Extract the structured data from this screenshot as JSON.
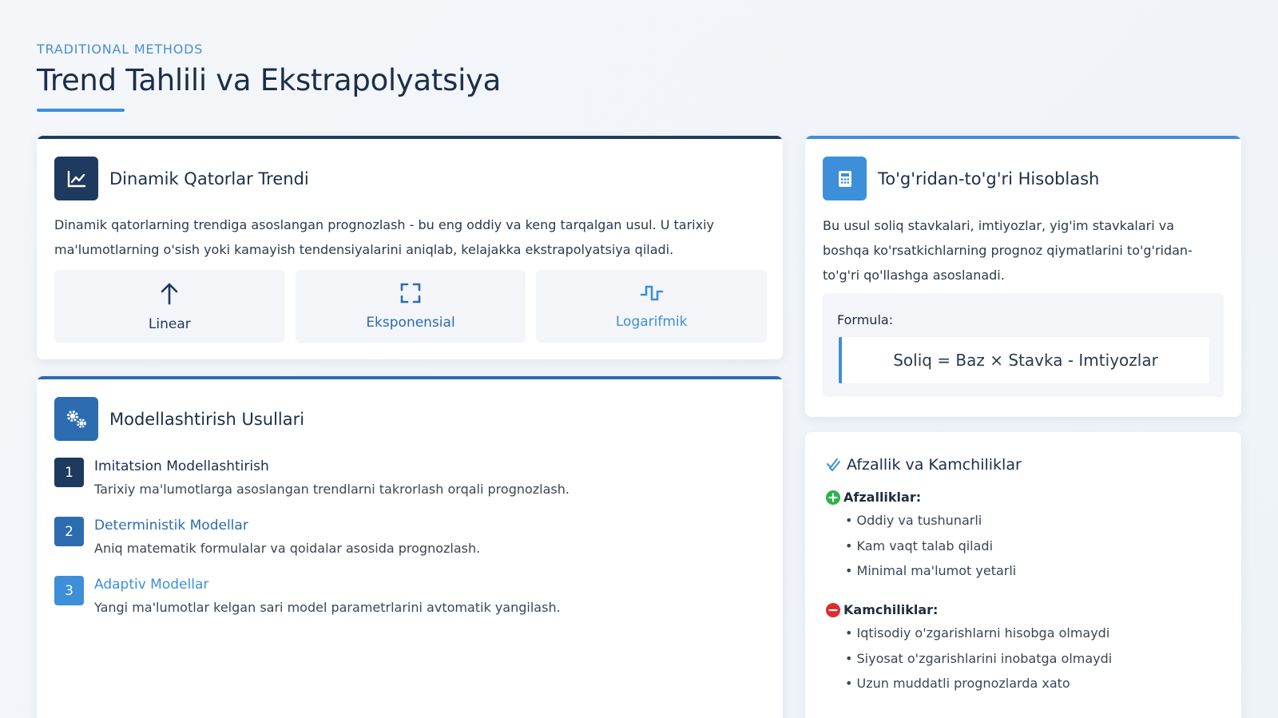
{
  "header": {
    "eyebrow": "TRADITIONAL METHODS",
    "title": "Trend Tahlili va Ekstrapolyatsiya"
  },
  "colors": {
    "navy": "#1e3a5f",
    "mid_blue": "#2c6cb0",
    "light_blue": "#3d8fd9",
    "green": "#2bb34a",
    "red": "#e02b2b"
  },
  "trend_card": {
    "icon": "chart-line-icon",
    "title": "Dinamik Qatorlar Trendi",
    "description": "Dinamik qatorlarning trendiga asoslangan prognozlash - bu eng oddiy va keng tarqalgan usul. U tarixiy ma'lumotlarning o'sish yoki kamayish tendensiyalarini aniqlab, kelajakka ekstrapolyatsiya qiladi.",
    "methods": [
      {
        "label": "Linear",
        "icon": "arrow-up-icon"
      },
      {
        "label": "Eksponensial",
        "icon": "expand-icon"
      },
      {
        "label": "Logarifmik",
        "icon": "wave-square-icon"
      }
    ]
  },
  "models_card": {
    "icon": "cogs-icon",
    "title": "Modellashtirish Usullari",
    "items": [
      {
        "num": "1",
        "title": "Imitatsion Modellashtirish",
        "desc": "Tarixiy ma'lumotlarga asoslangan trendlarni takrorlash orqali prognozlash."
      },
      {
        "num": "2",
        "title": "Deterministik Modellar",
        "desc": "Aniq matematik formulalar va qoidalar asosida prognozlash."
      },
      {
        "num": "3",
        "title": "Adaptiv Modellar",
        "desc": "Yangi ma'lumotlar kelgan sari model parametrlarini avtomatik yangilash."
      }
    ]
  },
  "calc_card": {
    "icon": "calculator-icon",
    "title": "To'g'ridan-to'g'ri Hisoblash",
    "description": "Bu usul soliq stavkalari, imtiyozlar, yig'im stavkalari va boshqa ko'rsatkichlarning prognoz qiymatlarini to'g'ridan-to'g'ri qo'llashga asoslanadi.",
    "formula_label": "Formula:",
    "formula": "Soliq = Baz × Stavka - Imtiyozlar"
  },
  "pros_card": {
    "icon": "check-double-icon",
    "title": "Afzallik va Kamchiliklar",
    "pros_title": "Afzalliklar:",
    "pros": [
      "• Oddiy va tushunarli",
      "• Kam vaqt talab qiladi",
      "• Minimal ma'lumot yetarli"
    ],
    "cons_title": "Kamchiliklar:",
    "cons": [
      "• Iqtisodiy o'zgarishlarni hisobga olmaydi",
      "• Siyosat o'zgarishlarini inobatga olmaydi",
      "• Uzun muddatli prognozlarda xato"
    ]
  }
}
